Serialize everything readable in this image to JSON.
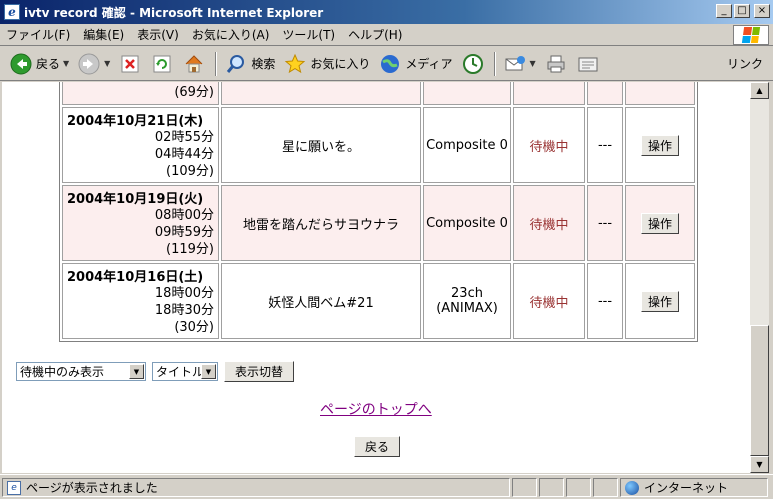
{
  "window": {
    "title": "ivtv record 確認 - Microsoft Internet Explorer",
    "app_icon": "ie-page-icon",
    "controls": [
      "_",
      "□",
      "×"
    ]
  },
  "menu": {
    "items": [
      "ファイル(F)",
      "編集(E)",
      "表示(V)",
      "お気に入り(A)",
      "ツール(T)",
      "ヘルプ(H)"
    ]
  },
  "toolbar": {
    "back_label": "戻る",
    "search_label": "検索",
    "favorites_label": "お気に入り",
    "media_label": "メディア",
    "links_label": "リンク"
  },
  "table": {
    "partial_row": {
      "duration": "(69分)"
    },
    "rows": [
      {
        "date": "2004年10月21日(木)",
        "start": "02時55分",
        "end": "04時44分",
        "duration": "(109分)",
        "title": "星に願いを。",
        "channel": "Composite 0",
        "channel_sub": "",
        "status": "待機中",
        "extra": "---",
        "action": "操作",
        "highlight": false
      },
      {
        "date": "2004年10月19日(火)",
        "start": "08時00分",
        "end": "09時59分",
        "duration": "(119分)",
        "title": "地雷を踏んだらサヨウナラ",
        "channel": "Composite 0",
        "channel_sub": "",
        "status": "待機中",
        "extra": "---",
        "action": "操作",
        "highlight": true
      },
      {
        "date": "2004年10月16日(土)",
        "start": "18時00分",
        "end": "18時30分",
        "duration": "(30分)",
        "title": "妖怪人間ベム#21",
        "channel": "23ch",
        "channel_sub": "(ANIMAX)",
        "status": "待機中",
        "extra": "---",
        "action": "操作",
        "highlight": false
      }
    ]
  },
  "controls": {
    "filter_select": "待機中のみ表示",
    "sort_select": "タイトル",
    "switch_button": "表示切替"
  },
  "page_top_link": "ページのトップへ",
  "back_button": "戻る",
  "status": {
    "message": "ページが表示されました",
    "zone": "インターネット"
  }
}
